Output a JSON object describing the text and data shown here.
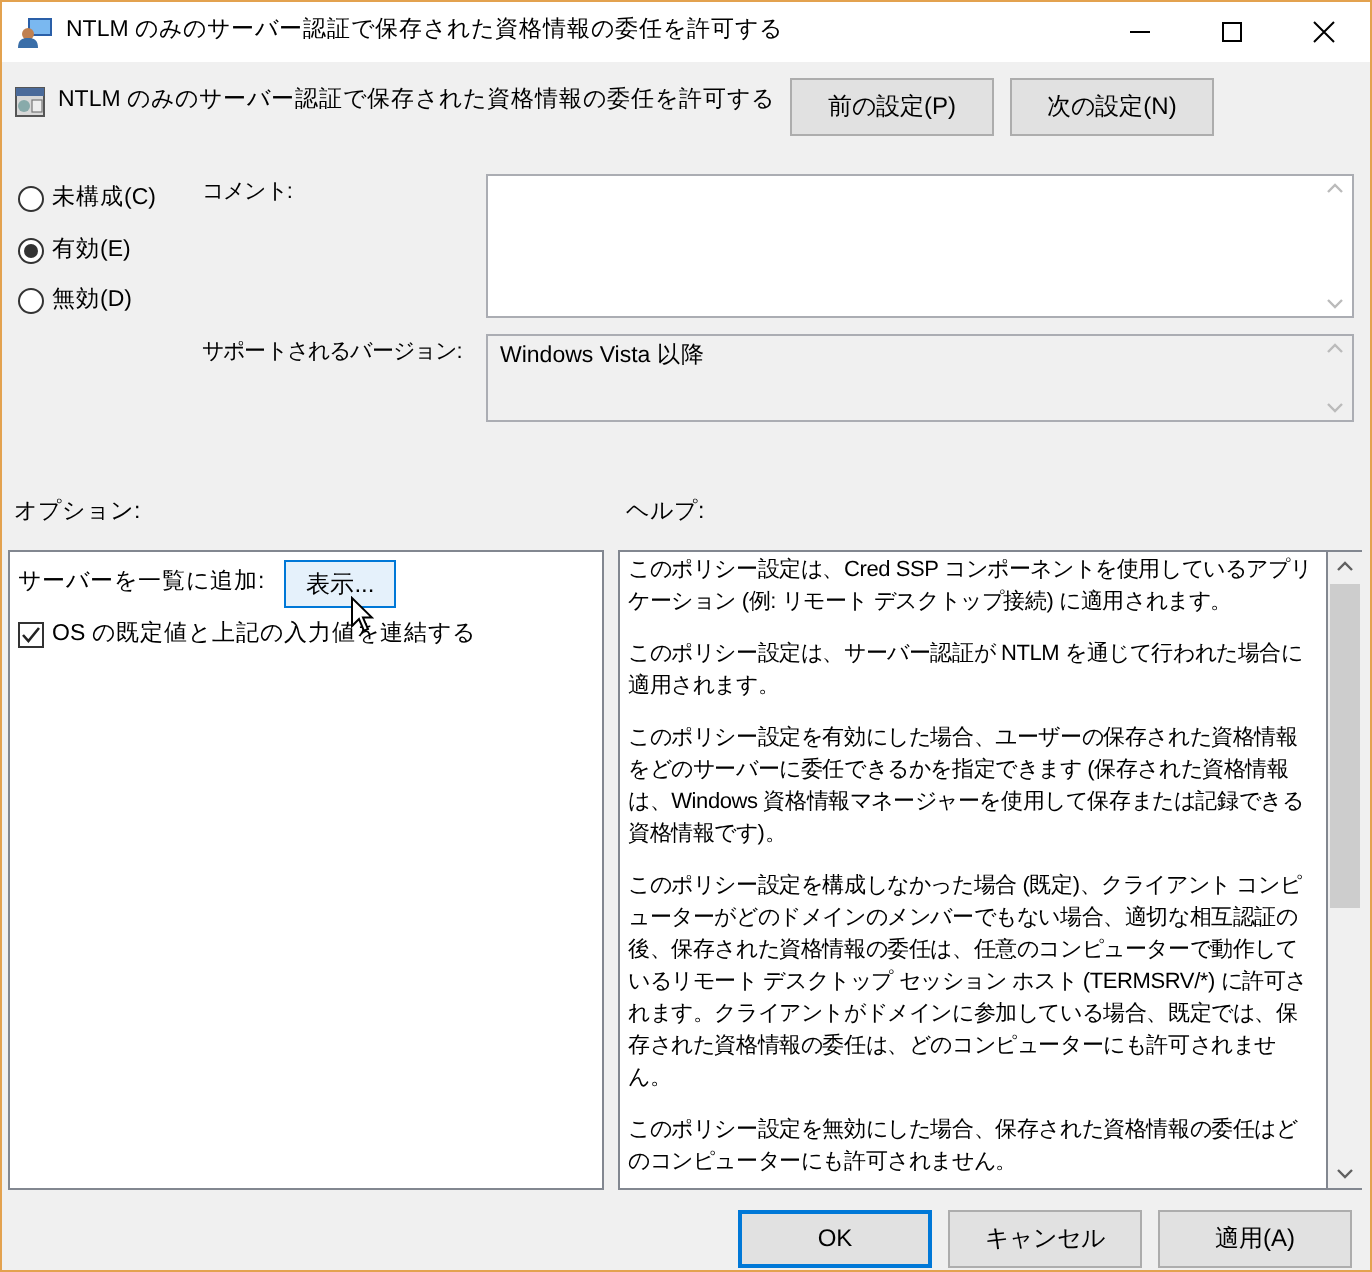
{
  "window": {
    "title": "NTLM のみのサーバー認証で保存された資格情報の委任を許可する"
  },
  "policy": {
    "title": "NTLM のみのサーバー認証で保存された資格情報の委任を許可する"
  },
  "nav_buttons": [
    "前の設定(P)",
    "次の設定(N)"
  ],
  "states": [
    {
      "label": "未構成(C)",
      "selected": false
    },
    {
      "label": "有効(E)",
      "selected": true
    },
    {
      "label": "無効(D)",
      "selected": false
    }
  ],
  "comment": {
    "label": "コメント:"
  },
  "supported": {
    "label": "サポートされるバージョン:",
    "value": "Windows Vista 以降"
  },
  "options": {
    "label": "オプション:",
    "items": [
      {
        "kind": "button",
        "label": "サーバーを一覧に追加:",
        "button": "表示..."
      },
      {
        "kind": "checkbox",
        "label": "OS の既定値と上記の入力値を連結する",
        "checked": true
      }
    ]
  },
  "help": {
    "label": "ヘルプ:",
    "paragraphs": [
      "このポリシー設定は、Cred SSP コンポーネントを使用しているアプリケーション (例: リモート デスクトップ接続) に適用されます。",
      "このポリシー設定は、サーバー認証が NTLM を通じて行われた場合に適用されます。",
      "このポリシー設定を有効にした場合、ユーザーの保存された資格情報をどのサーバーに委任できるかを指定できます (保存された資格情報は、Windows 資格情報マネージャーを使用して保存または記録できる資格情報です)。",
      "このポリシー設定を構成しなかった場合 (既定)、クライアント コンピューターがどのドメインのメンバーでもない場合、適切な相互認証の後、保存された資格情報の委任は、任意のコンピューターで動作しているリモート デスクトップ セッション ホスト (TERMSRV/*) に許可されます。クライアントがドメインに参加している場合、既定では、保存された資格情報の委任は、どのコンピューターにも許可されません。",
      "このポリシー設定を無効にした場合、保存された資格情報の委任はどのコンピューターにも許可されません。"
    ]
  },
  "buttons": [
    {
      "label": "OK",
      "default": true
    },
    {
      "label": "キャンセル",
      "default": false
    },
    {
      "label": "適用(A)",
      "default": false
    }
  ]
}
